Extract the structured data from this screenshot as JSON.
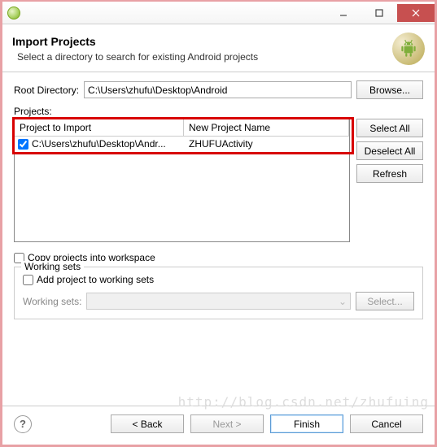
{
  "titlebar": {
    "app_icon": "eclipse-icon",
    "minimize": "—",
    "maximize": "□",
    "close": "×"
  },
  "header": {
    "title": "Import Projects",
    "subtitle": "Select a directory to search for existing Android projects"
  },
  "root_directory": {
    "label": "Root Directory:",
    "value": "C:\\Users\\zhufu\\Desktop\\Android",
    "browse": "Browse..."
  },
  "projects_label": "Projects:",
  "table": {
    "columns": [
      "Project to Import",
      "New Project Name"
    ],
    "rows": [
      {
        "checked": true,
        "path": "C:\\Users\\zhufu\\Desktop\\Andr...",
        "name": "ZHUFUActivity"
      }
    ]
  },
  "side_buttons": {
    "select_all": "Select All",
    "deselect_all": "Deselect All",
    "refresh": "Refresh"
  },
  "copy_checkbox": {
    "checked": false,
    "label": "Copy projects into workspace"
  },
  "working_sets": {
    "group_title": "Working sets",
    "add_checkbox": {
      "checked": false,
      "label": "Add project to working sets"
    },
    "ws_label": "Working sets:",
    "select_btn": "Select..."
  },
  "footer": {
    "back": "< Back",
    "next": "Next >",
    "finish": "Finish",
    "cancel": "Cancel"
  },
  "watermark": "http://blog.csdn.net/zhufuing"
}
